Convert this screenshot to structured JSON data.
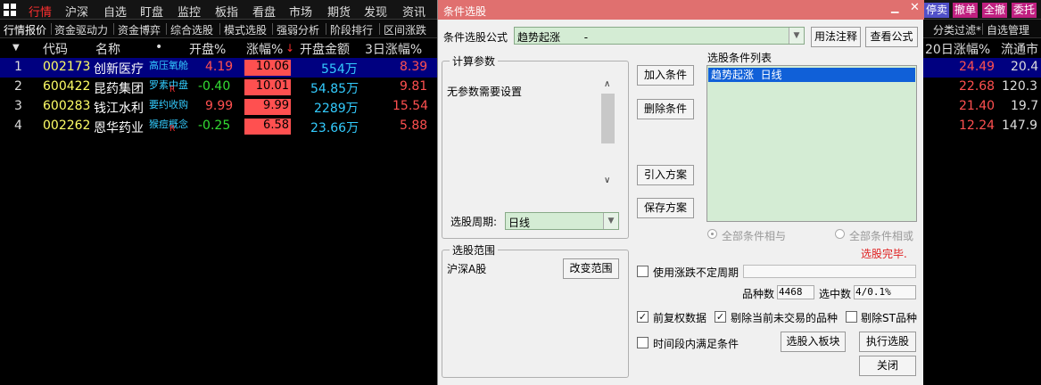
{
  "top_nav": {
    "items": [
      "行情",
      "沪深",
      "自选",
      "盯盘",
      "监控",
      "板指",
      "看盘",
      "市场",
      "期货",
      "发现",
      "资讯"
    ],
    "right_buttons": [
      "停卖",
      "撤单",
      "全撤",
      "委托"
    ]
  },
  "sub_nav": {
    "tabs": [
      "行情报价",
      "资金驱动力",
      "资金博弈",
      "综合选股",
      "模式选股",
      "强弱分析",
      "阶段排行",
      "区间涨跌"
    ],
    "right_tabs": [
      "分类过滤*",
      "自选管理"
    ]
  },
  "table": {
    "headers": [
      "代码",
      "名称",
      "•",
      "开盘%",
      "涨幅%",
      "开盘金额",
      "3日涨幅%"
    ],
    "sort_indicator": "↓",
    "right_headers": [
      "20日涨幅%",
      "流通市"
    ],
    "rows": [
      {
        "idx": "1",
        "code": "002173",
        "name": "创新医疗",
        "tag": "高压氧舱",
        "badge": "",
        "open_pct": "4.19",
        "change_pct": "10.06",
        "amount": "554万",
        "d3": "8.39",
        "d20": "24.49",
        "float": "20.4"
      },
      {
        "idx": "2",
        "code": "600422",
        "name": "昆药集团",
        "tag": "罗素中盘",
        "badge": "R",
        "open_pct": "-0.40",
        "change_pct": "10.01",
        "amount": "54.85万",
        "d3": "9.81",
        "d20": "22.68",
        "float": "120.3"
      },
      {
        "idx": "3",
        "code": "600283",
        "name": "钱江水利",
        "tag": "要约收购",
        "badge": "",
        "open_pct": "9.99",
        "change_pct": "9.99",
        "amount": "2289万",
        "d3": "15.54",
        "d20": "21.40",
        "float": "19.7"
      },
      {
        "idx": "4",
        "code": "002262",
        "name": "恩华药业",
        "tag": "猴痘概念",
        "badge": "R",
        "open_pct": "-0.25",
        "change_pct": "6.58",
        "amount": "23.66万",
        "d3": "5.88",
        "d20": "12.24",
        "float": "147.9"
      }
    ]
  },
  "dialog": {
    "title": "条件选股",
    "formula_label": "条件选股公式",
    "formula_value": "趋势起涨       -",
    "usage_button": "用法注释",
    "view_formula_button": "查看公式",
    "params_group_title": "计算参数",
    "params_text": "无参数需要设置",
    "period_label": "选股周期:",
    "period_value": "日线",
    "add_button": "加入条件",
    "delete_button": "删除条件",
    "import_button": "引入方案",
    "save_button": "保存方案",
    "conditions_list_title": "选股条件列表",
    "conditions": [
      "趋势起涨  日线"
    ],
    "radio_and": "全部条件相与",
    "radio_or": "全部条件相或",
    "done_text": "选股完毕.",
    "range_group_title": "选股范围",
    "range_value": "沪深A股",
    "change_range_button": "改变范围",
    "use_variable_period": "使用涨跌不定周期",
    "count_label": "品种数",
    "count_value": "4468",
    "selected_label": "选中数",
    "selected_value": "4/0.1%",
    "prev_adjust": "前复权数据",
    "exclude_untraded": "剔除当前未交易的品种",
    "exclude_st": "剔除ST品种",
    "time_condition": "时间段内满足条件",
    "to_block_button": "选股入板块",
    "run_button": "执行选股",
    "close_button": "关闭"
  },
  "colors": {
    "title_bar": "#e0706f",
    "nav_active": "#ff3030",
    "green_field": "#d4ecd4",
    "selection": "#000080"
  }
}
